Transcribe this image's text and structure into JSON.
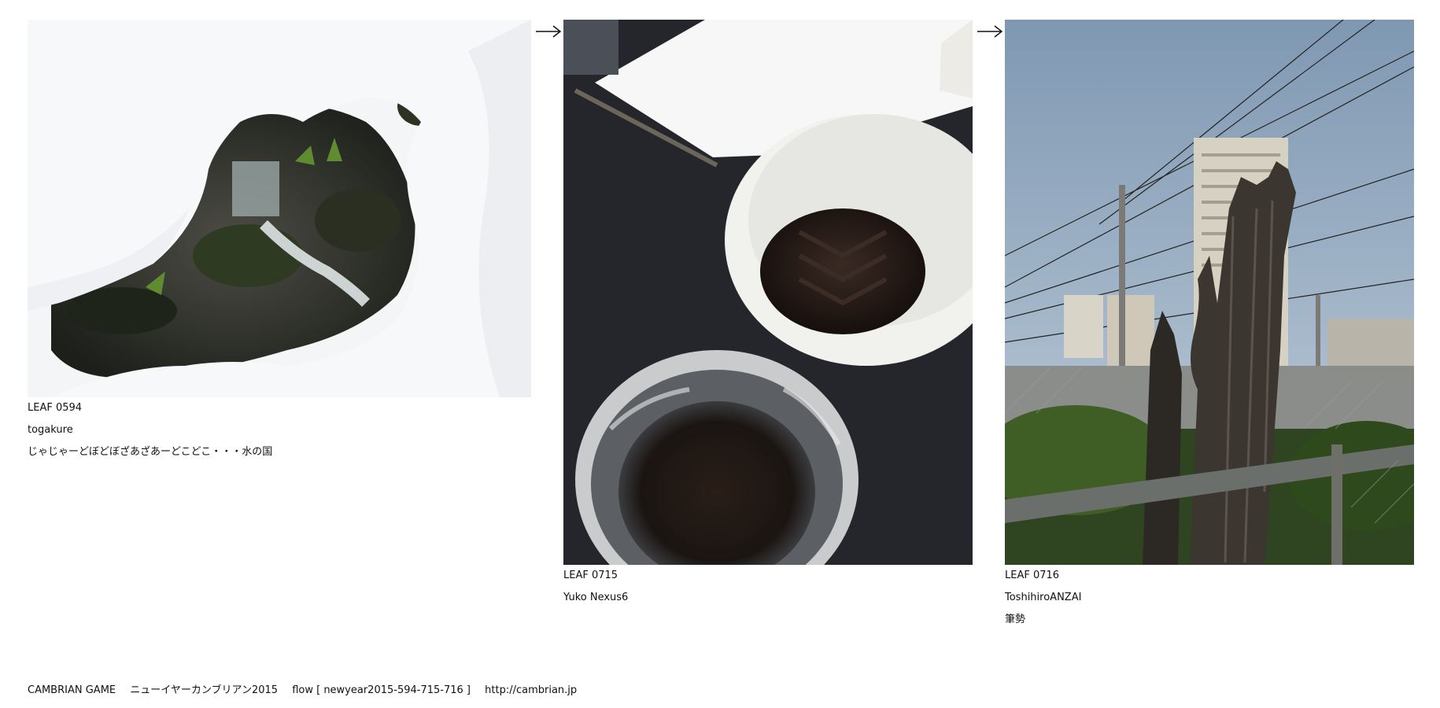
{
  "leaves": [
    {
      "number": "LEAF 0594",
      "author": "togakure",
      "comment": "じゃじゃーどぼどぼざあざあーどこどこ・・・水の国"
    },
    {
      "number": "LEAF 0715",
      "author": "Yuko Nexus6",
      "comment": ""
    },
    {
      "number": "LEAF 0716",
      "author": "ToshihiroANZAI",
      "comment": "筆勢"
    }
  ],
  "footer": {
    "game": "CAMBRIAN GAME",
    "event": "ニューイヤーカンブリアン2015",
    "flow": "flow [ newyear2015-594-715-716 ]",
    "url": "http://cambrian.jp"
  },
  "icons": [
    "arrow-right-icon",
    "arrow-right-icon"
  ]
}
